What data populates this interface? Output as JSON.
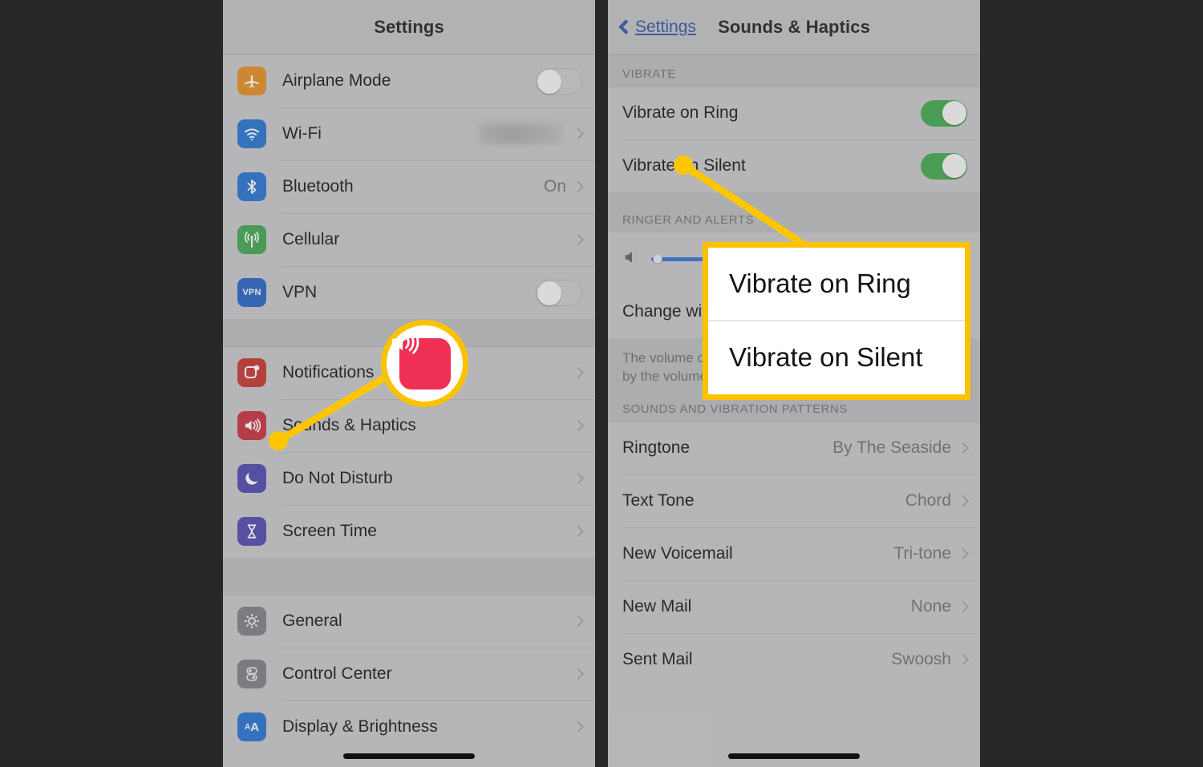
{
  "background_color": "#272727",
  "accent_colors": {
    "highlight_yellow": "#fcc200",
    "toggle_on_green": "#3da64a",
    "link_blue": "#2d4ea2",
    "slider_blue": "#2f6fd0"
  },
  "left_panel": {
    "nav": {
      "title": "Settings"
    },
    "groups": [
      {
        "rows": [
          {
            "icon": "airplane-icon",
            "icon_color": "#e08b1a",
            "label": "Airplane Mode",
            "control": "toggle",
            "toggle_state": "off"
          },
          {
            "icon": "wifi-icon",
            "icon_color": "#1f6fd0",
            "label": "Wi-Fi",
            "control": "blurred-value",
            "value": "",
            "chevron": true
          },
          {
            "icon": "bluetooth-icon",
            "icon_color": "#1f6fd0",
            "label": "Bluetooth",
            "control": "value",
            "value": "On",
            "chevron": true
          },
          {
            "icon": "cellular-icon",
            "icon_color": "#3aa34a",
            "label": "Cellular",
            "control": "chevron",
            "value": "",
            "chevron": true
          },
          {
            "icon": "vpn-icon",
            "icon_color": "#1f5fc0",
            "label": "VPN",
            "control": "toggle",
            "toggle_state": "off"
          }
        ]
      },
      {
        "rows": [
          {
            "icon": "notifications-icon",
            "icon_color": "#c4302b",
            "label": "Notifications",
            "control": "chevron",
            "value": "",
            "chevron": true
          },
          {
            "icon": "sounds-haptics-icon",
            "icon_color": "#c42b3a",
            "label": "Sounds & Haptics",
            "control": "chevron",
            "value": "",
            "chevron": true
          },
          {
            "icon": "do-not-disturb-icon",
            "icon_color": "#4b43ad",
            "label": "Do Not Disturb",
            "control": "chevron",
            "value": "",
            "chevron": true
          },
          {
            "icon": "screen-time-icon",
            "icon_color": "#4b43ad",
            "label": "Screen Time",
            "control": "chevron",
            "value": "",
            "chevron": true
          }
        ]
      },
      {
        "rows": [
          {
            "icon": "general-gear-icon",
            "icon_color": "#7b7b80",
            "label": "General",
            "control": "chevron",
            "value": "",
            "chevron": true
          },
          {
            "icon": "control-center-icon",
            "icon_color": "#7b7b80",
            "label": "Control Center",
            "control": "chevron",
            "value": "",
            "chevron": true
          },
          {
            "icon": "display-brightness-icon",
            "icon_color": "#1f6fd0",
            "label": "Display & Brightness",
            "control": "chevron",
            "value": "",
            "chevron": true
          }
        ]
      }
    ]
  },
  "right_panel": {
    "nav": {
      "back_label": "Settings",
      "title": "Sounds & Haptics"
    },
    "section_vibrate": {
      "header": "VIBRATE",
      "rows": [
        {
          "label": "Vibrate on Ring",
          "toggle_state": "on"
        },
        {
          "label": "Vibrate on Silent",
          "toggle_state": "on"
        }
      ]
    },
    "section_ringer": {
      "header": "RINGER AND ALERTS",
      "slider": {
        "icon": "speaker-icon",
        "fill_percent": 45
      },
      "change_with_buttons": {
        "label": "Change with Buttons",
        "toggle_state": "off"
      },
      "footnote": "The volume of the ringer and alerts will not be affected by the volume buttons."
    },
    "section_patterns": {
      "header": "SOUNDS AND VIBRATION PATTERNS",
      "rows": [
        {
          "label": "Ringtone",
          "value": "By The Seaside"
        },
        {
          "label": "Text Tone",
          "value": "Chord"
        },
        {
          "label": "New Voicemail",
          "value": "Tri-tone"
        },
        {
          "label": "New Mail",
          "value": "None"
        },
        {
          "label": "Sent Mail",
          "value": "Swoosh"
        }
      ]
    }
  },
  "annotations": {
    "highlight_icon_name": "sounds-haptics-icon",
    "callout": {
      "items": [
        {
          "text": "Vibrate on Ring"
        },
        {
          "text": "Vibrate on Silent"
        }
      ]
    }
  }
}
